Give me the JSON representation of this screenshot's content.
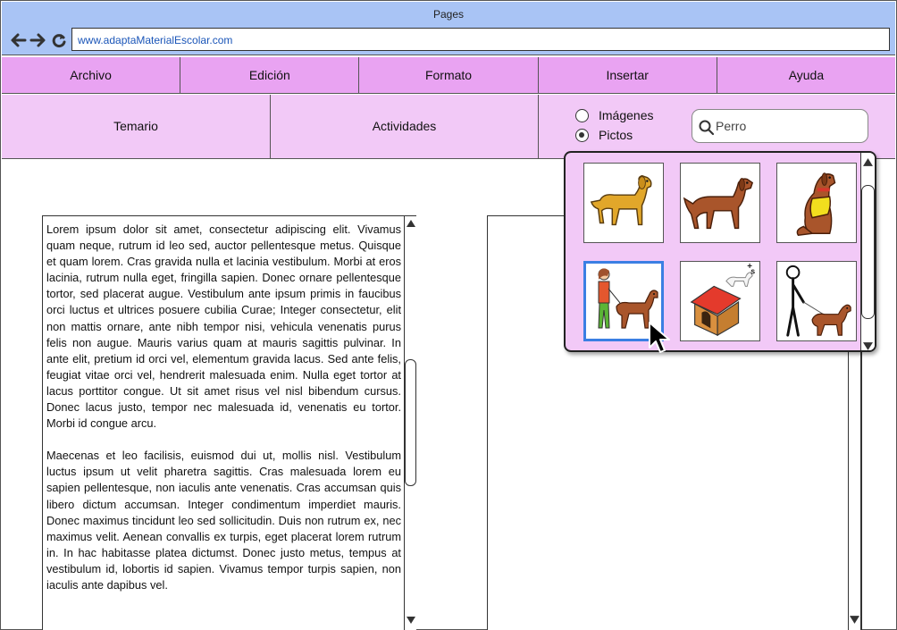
{
  "window": {
    "title": "Pages"
  },
  "browser": {
    "url": "www.adaptaMaterialEscolar.com"
  },
  "menu": {
    "items": [
      {
        "label": "Archivo"
      },
      {
        "label": "Edición"
      },
      {
        "label": "Formato"
      },
      {
        "label": "Insertar"
      },
      {
        "label": "Ayuda"
      }
    ]
  },
  "toolbar": {
    "tabs": [
      {
        "label": "Temario"
      },
      {
        "label": "Actividades"
      }
    ],
    "image_type": {
      "options": [
        {
          "label": "Imágenes",
          "checked": false
        },
        {
          "label": "Pictos",
          "checked": true
        }
      ]
    },
    "search": {
      "value": "Perro"
    }
  },
  "document": {
    "paragraphs": [
      "Lorem ipsum dolor sit amet, consectetur adipiscing elit. Vivamus quam neque, rutrum id leo sed, auctor pellentesque metus. Quisque et quam lorem. Cras gravida nulla et lacinia vestibulum. Morbi at eros lacinia, rutrum nulla eget, fringilla sapien. Donec ornare pellentesque tortor, sed placerat augue. Vestibulum ante ipsum primis in faucibus orci luctus et ultrices posuere cubilia Curae; Integer consectetur, elit non mattis ornare, ante nibh tempor nisi, vehicula venenatis purus felis non augue. Mauris varius quam at mauris sagittis pulvinar. In ante elit, pretium id orci vel, elementum gravida lacus. Sed ante felis, feugiat vitae orci vel, hendrerit malesuada enim. Nulla eget tortor at lacus porttitor congue. Ut sit amet risus vel nisl bibendum cursus. Donec lacus justo, tempor nec malesuada id, venenatis eu tortor. Morbi id congue arcu.",
      "Maecenas et leo facilisis, euismod dui ut, mollis nisl. Vestibulum luctus ipsum ut velit pharetra sagittis. Cras malesuada lorem eu sapien pellentesque, non iaculis ante venenatis. Cras accumsan quis libero dictum accumsan. Integer condimentum imperdiet mauris. Donec maximus tincidunt leo sed sollicitudin. Duis non rutrum ex, nec maximus velit. Aenean convallis ex turpis, eget placerat lorem rutrum in. In hac habitasse platea dictumst. Donec justo metus, tempus at vestibulum id, lobortis id sapien. Vivamus tempor turpis sapien, non iaculis ante dapibus vel."
    ]
  },
  "pictogram_results": {
    "items": [
      {
        "icon": "yellow-dog-pictogram-icon",
        "selected": false
      },
      {
        "icon": "brown-dog-pictogram-icon",
        "selected": false
      },
      {
        "icon": "sitting-dog-with-vest-pictogram-icon",
        "selected": false
      },
      {
        "icon": "girl-walking-dog-pictogram-icon",
        "selected": true
      },
      {
        "icon": "dog-house-pictogram-icon",
        "selected": false
      },
      {
        "icon": "stick-figure-walking-dog-pictogram-icon",
        "selected": false
      }
    ],
    "plural_marker": "s"
  },
  "colors": {
    "titlebar": "#a9c4f5",
    "menubar": "#e9a3f2",
    "toolbar": "#f2c9f7",
    "selection": "#3b7fe3",
    "url_text": "#1a55b8"
  }
}
